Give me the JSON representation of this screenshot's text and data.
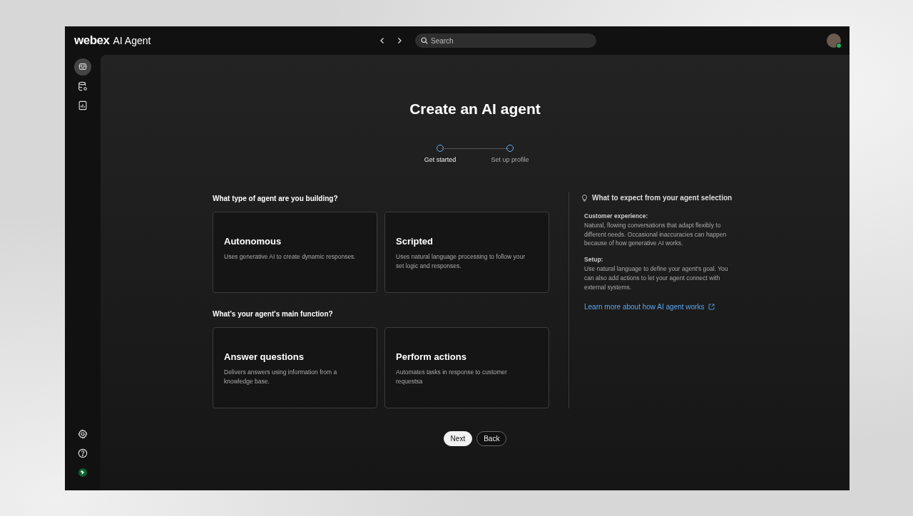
{
  "app": {
    "brand": "webex",
    "product": "AI Agent"
  },
  "top_bar": {
    "search": {
      "placeholder": "Search"
    }
  },
  "sidebar": {
    "items": [
      {
        "kind": "agent",
        "selected": true
      },
      {
        "kind": "database",
        "selected": false
      },
      {
        "kind": "report",
        "selected": false
      }
    ],
    "bottom_items": [
      {
        "kind": "settings"
      },
      {
        "kind": "help"
      },
      {
        "kind": "status"
      }
    ]
  },
  "page": {
    "title": "Create an AI agent",
    "steps": [
      {
        "label": "Get started",
        "selected": true
      },
      {
        "label": "Set up profile",
        "selected": false
      }
    ],
    "sections": [
      {
        "question": "What type of agent are you building?",
        "options": [
          {
            "title": "Autonomous",
            "description": "Uses generative AI to create dynamic responses."
          },
          {
            "title": "Scripted",
            "description": "Uses natural language processing to follow your set logic and responses."
          }
        ]
      },
      {
        "question": "What's your agent's main function?",
        "options": [
          {
            "title": "Answer questions",
            "description": "Delivers answers using information from a knowledge base."
          },
          {
            "title": "Perform actions",
            "description": "Automates tasks in response to customer requestsa"
          }
        ]
      }
    ],
    "info": {
      "title": "What to expect from your agent selection",
      "blocks": [
        {
          "heading": "Customer experience:",
          "text": "Natural, flowing conversations that adapt flexibly to different needs. Occasional inaccuracies can happen because of how generative AI works."
        },
        {
          "heading": "Setup:",
          "text": "Use natural language to define your agent's goal. You can also add actions to let your agent connect with external systems."
        }
      ],
      "link": "Learn more about how AI agent works"
    },
    "buttons": [
      {
        "label": "Next",
        "kind": "primary"
      },
      {
        "label": "Back",
        "kind": "secondary"
      }
    ]
  }
}
